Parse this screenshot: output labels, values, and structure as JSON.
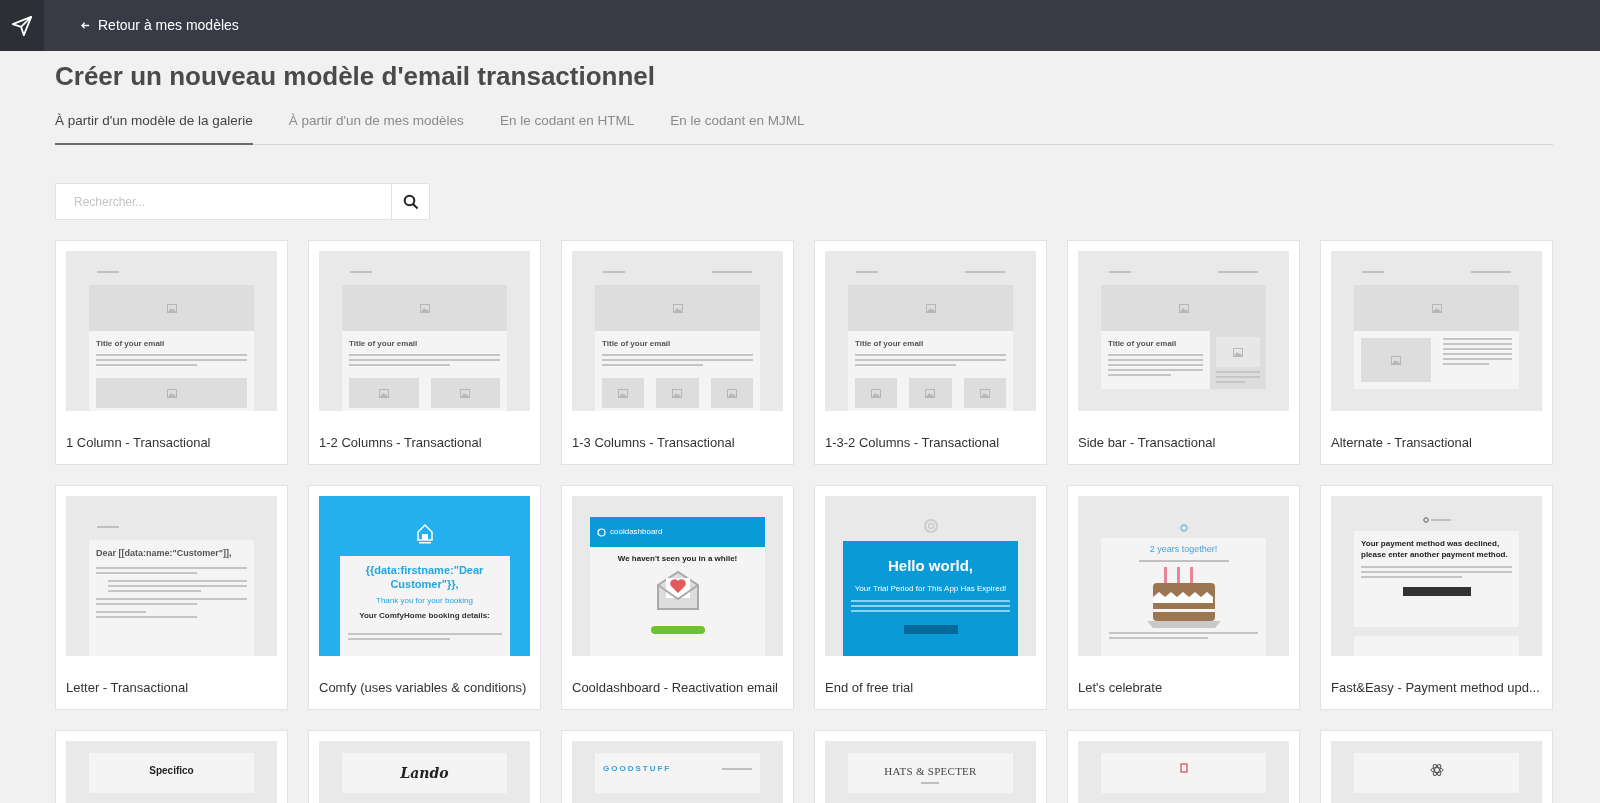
{
  "topbar": {
    "back_link": "Retour à mes modèles"
  },
  "page": {
    "title": "Créer un nouveau modèle d'email transactionnel"
  },
  "tabs": [
    {
      "label": "À partir d'un modèle de la galerie",
      "selected": true
    },
    {
      "label": "À partir d'un de mes modèles",
      "selected": false
    },
    {
      "label": "En le codant en HTML",
      "selected": false
    },
    {
      "label": "En le codant en MJML",
      "selected": false
    }
  ],
  "search": {
    "placeholder": "Rechercher..."
  },
  "templates": [
    {
      "name": "1 Column - Transactional",
      "preview": {
        "kind": "one-column",
        "title": "Title of your email"
      }
    },
    {
      "name": "1-2 Columns - Transactional",
      "preview": {
        "kind": "two-columns",
        "title": "Title of your email"
      }
    },
    {
      "name": "1-3 Columns - Transactional",
      "preview": {
        "kind": "three-columns",
        "title": "Title of your email"
      }
    },
    {
      "name": "1-3-2 Columns - Transactional",
      "preview": {
        "kind": "three-columns",
        "title": "Title of your email"
      }
    },
    {
      "name": "Side bar - Transactional",
      "preview": {
        "kind": "sidebar",
        "title": "Title of your email"
      }
    },
    {
      "name": "Alternate - Transactional",
      "preview": {
        "kind": "alternate"
      }
    },
    {
      "name": "Letter - Transactional",
      "preview": {
        "kind": "letter",
        "title": "Dear [[data:name:\"Customer\"]],"
      }
    },
    {
      "name": "Comfy (uses variables & conditions)",
      "preview": {
        "kind": "comfy",
        "title": "{{data:firstname:\"Dear Customer\"}},",
        "subtitle": "Thank you for your booking",
        "detail": "Your ComfyHome booking details:"
      }
    },
    {
      "name": "Cooldashboard - Reactivation email",
      "preview": {
        "kind": "dashboard",
        "brand": "cooldashboard",
        "title": "We haven't seen you in a while!"
      }
    },
    {
      "name": "End of free trial",
      "preview": {
        "kind": "trial",
        "title": "Hello world,",
        "subtitle": "Your Trial Period for This App Has Expired!"
      }
    },
    {
      "name": "Let's celebrate",
      "preview": {
        "kind": "celebrate",
        "title": "2 years together!"
      }
    },
    {
      "name": "Fast&Easy - Payment method upd...",
      "preview": {
        "kind": "payment",
        "title": "Your payment method was declined, please enter another payment method."
      }
    },
    {
      "preview": {
        "kind": "brand-bold",
        "brand": "Specifico"
      }
    },
    {
      "preview": {
        "kind": "brand-script",
        "brand": "Lando"
      }
    },
    {
      "preview": {
        "kind": "brand-spaced",
        "brand": "GOODSTUFF"
      }
    },
    {
      "preview": {
        "kind": "brand-serif",
        "brand": "HATS & SPECTER"
      }
    },
    {
      "preview": {
        "kind": "badge-logo"
      }
    },
    {
      "preview": {
        "kind": "atom-logo"
      }
    }
  ]
}
